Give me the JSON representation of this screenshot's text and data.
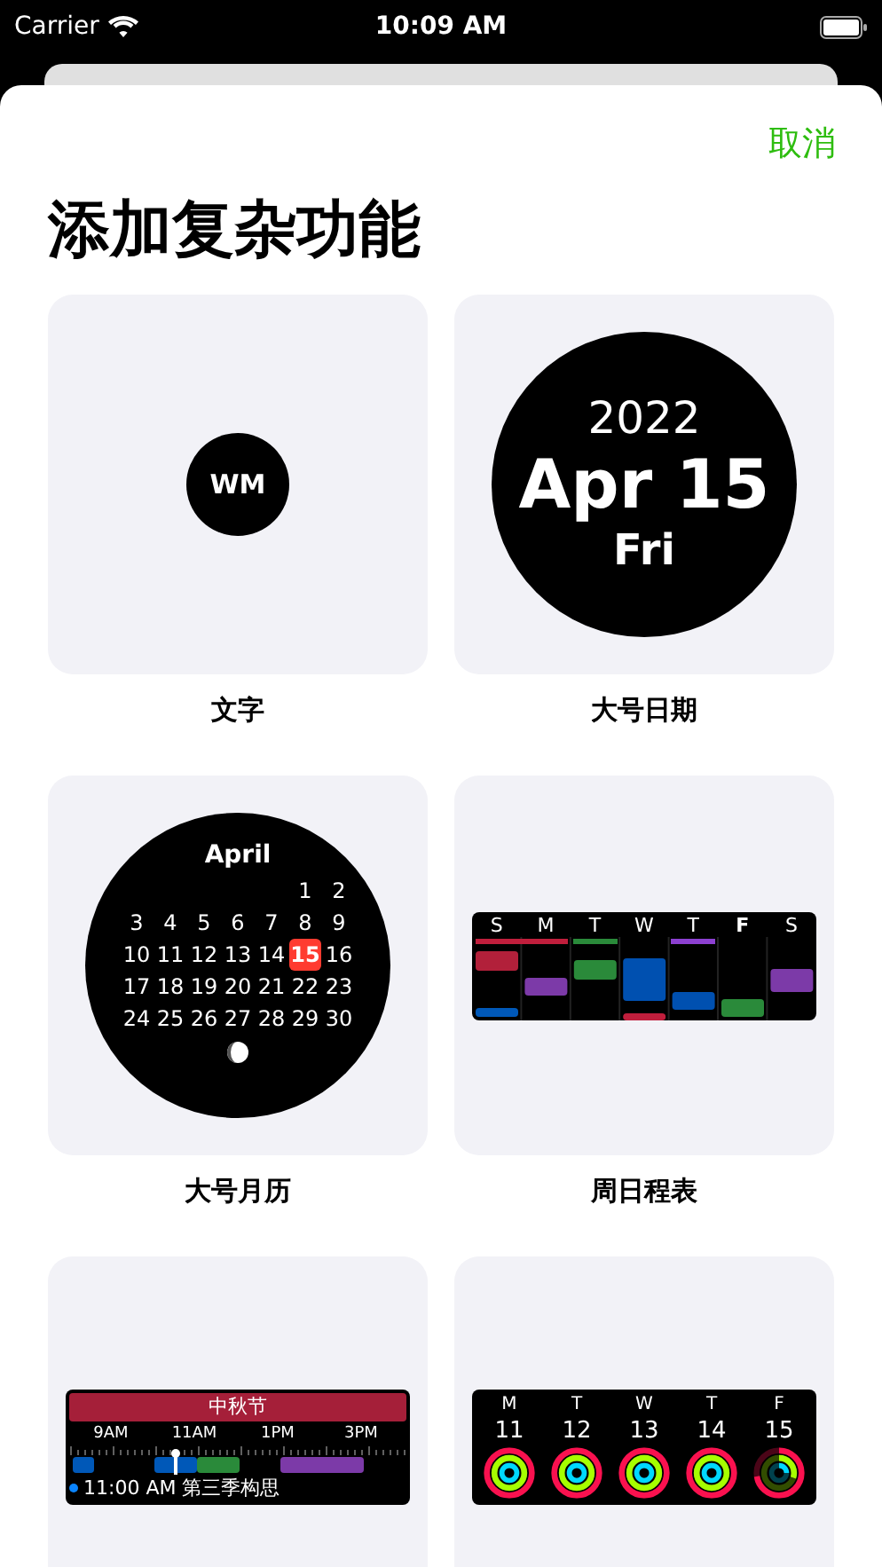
{
  "status_bar": {
    "carrier": "Carrier",
    "time": "10:09 AM"
  },
  "sheet": {
    "cancel": "取消",
    "title": "添加复杂功能"
  },
  "complication_rows": [
    [
      {
        "kind": "text",
        "text": "WM",
        "label": "文字"
      },
      {
        "kind": "large_date",
        "year": "2022",
        "date": "Apr 15",
        "weekday": "Fri",
        "label": "大号日期"
      }
    ],
    [
      {
        "kind": "month_calendar",
        "month": "April",
        "weeks": [
          [
            {
              "day": "1",
              "selected": false
            },
            {
              "day": "2",
              "selected": false
            }
          ],
          [
            {
              "day": "3",
              "selected": false
            },
            {
              "day": "4",
              "selected": false
            },
            {
              "day": "5",
              "selected": false
            },
            {
              "day": "6",
              "selected": false
            },
            {
              "day": "7",
              "selected": false
            },
            {
              "day": "8",
              "selected": false
            },
            {
              "day": "9",
              "selected": false
            }
          ],
          [
            {
              "day": "10",
              "selected": false
            },
            {
              "day": "11",
              "selected": false
            },
            {
              "day": "12",
              "selected": false
            },
            {
              "day": "13",
              "selected": false
            },
            {
              "day": "14",
              "selected": false
            },
            {
              "day": "15",
              "selected": true
            },
            {
              "day": "16",
              "selected": false
            }
          ],
          [
            {
              "day": "17",
              "selected": false
            },
            {
              "day": "18",
              "selected": false
            },
            {
              "day": "19",
              "selected": false
            },
            {
              "day": "20",
              "selected": false
            },
            {
              "day": "21",
              "selected": false
            },
            {
              "day": "22",
              "selected": false
            },
            {
              "day": "23",
              "selected": false
            }
          ],
          [
            {
              "day": "24",
              "selected": false
            },
            {
              "day": "25",
              "selected": false
            },
            {
              "day": "26",
              "selected": false
            },
            {
              "day": "27",
              "selected": false
            },
            {
              "day": "28",
              "selected": false
            },
            {
              "day": "29",
              "selected": false
            },
            {
              "day": "30",
              "selected": false
            }
          ]
        ],
        "label": "大号月历"
      },
      {
        "kind": "week_schedule",
        "days": [
          {
            "letter": "S",
            "today": false
          },
          {
            "letter": "M",
            "today": false
          },
          {
            "letter": "T",
            "today": false
          },
          {
            "letter": "W",
            "today": false
          },
          {
            "letter": "T",
            "today": false
          },
          {
            "letter": "F",
            "today": true
          },
          {
            "letter": "S",
            "today": false
          }
        ],
        "label": "周日程表"
      }
    ],
    [
      {
        "kind": "up_next",
        "banner": "中秋节",
        "times": [
          "9AM",
          "11AM",
          "1PM",
          "3PM"
        ],
        "event": "11:00 AM 第三季构思"
      },
      {
        "kind": "activity",
        "days": [
          {
            "letter": "M",
            "date": "11",
            "rings": [
              {
                "level": 1
              },
              {
                "level": 1
              },
              {
                "level": 1
              }
            ]
          },
          {
            "letter": "T",
            "date": "12",
            "rings": [
              {
                "level": 1
              },
              {
                "level": 1
              },
              {
                "level": 1
              }
            ]
          },
          {
            "letter": "W",
            "date": "13",
            "rings": [
              {
                "level": 1
              },
              {
                "level": 1
              },
              {
                "level": 1
              }
            ]
          },
          {
            "letter": "T",
            "date": "14",
            "rings": [
              {
                "level": 1
              },
              {
                "level": 1
              },
              {
                "level": 1
              }
            ]
          },
          {
            "letter": "F",
            "date": "15",
            "rings": [
              {
                "level": 0.72
              },
              {
                "level": 0.3
              },
              {
                "level": 0.25
              }
            ]
          }
        ]
      }
    ]
  ]
}
